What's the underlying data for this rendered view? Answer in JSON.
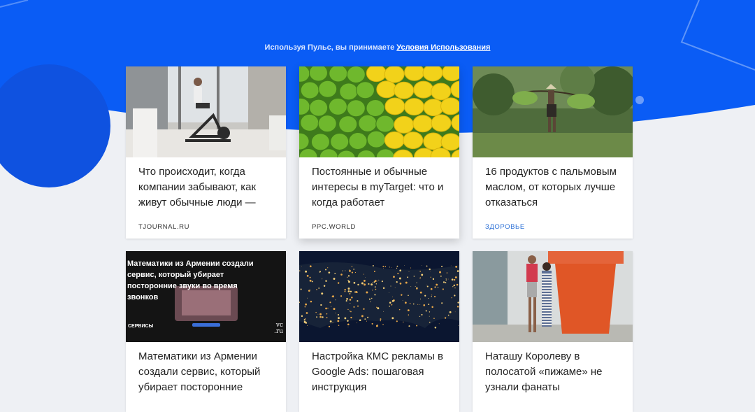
{
  "notice": {
    "text": "Используя Пульс, вы принимаете ",
    "link": "Условия Использования"
  },
  "colors": {
    "brand_blue": "#0a5cf5",
    "background": "#eef0f4",
    "tag_blue": "#2a6fd6"
  },
  "cards": [
    {
      "title": "Что происходит, когда компании забывают, как живут обычные люди —",
      "source": "TJOURNAL.RU",
      "image": "man-on-exercise-bike-photo"
    },
    {
      "title": "Постоянные и обычные интересы в myTarget: что и когда работает",
      "source": "PPC.WORLD",
      "image": "limes-and-lemons-photo"
    },
    {
      "title": "16 продуктов с пальмовым маслом, от которых лучше отказаться",
      "source": "ЗДОРОВЬЕ",
      "image": "farmer-carrying-rice-photo"
    },
    {
      "title": "Математики из Армении создали сервис, который убирает посторонние",
      "source": "",
      "image": "vc-article-preview",
      "overlay": {
        "headline": "Математики из Армении создали сервис, который убирает посторонние звуки во время звонков",
        "tag": "СЕРВИСЫ",
        "logo": "vc ru"
      }
    },
    {
      "title": "Настройка КМС рекламы в Google Ads: пошаговая инструкция",
      "source": "",
      "image": "night-map-usa-photo"
    },
    {
      "title": "Наташу Королеву в полосатой «пижаме» не узнали фанаты",
      "source": "",
      "image": "celebrity-couple-photo"
    }
  ]
}
